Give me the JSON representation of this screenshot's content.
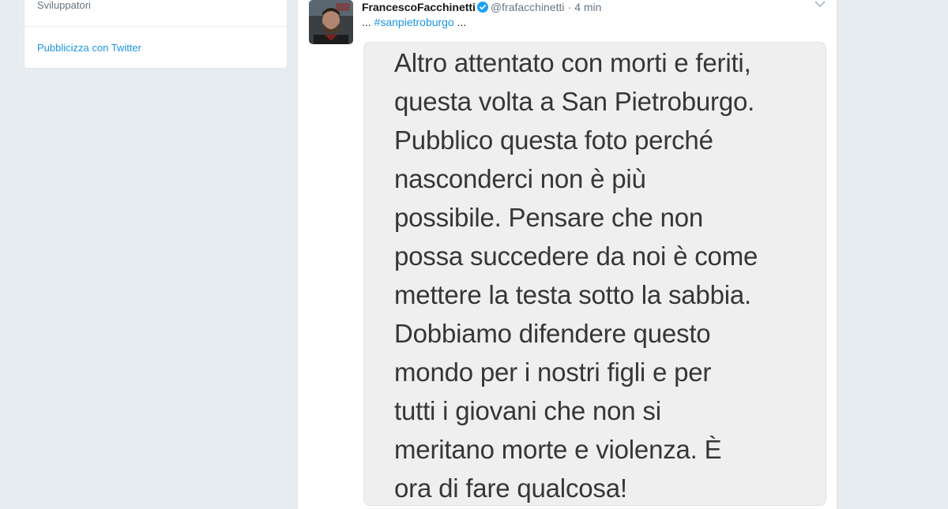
{
  "sidebar": {
    "developers_link": "Sviluppatori",
    "advertise_link": "Pubblicizza con Twitter"
  },
  "tweet": {
    "fullname": "FrancescoFacchinetti",
    "username": "@frafacchinetti",
    "separator": "·",
    "time": "4 min",
    "text_prefix": "...",
    "hashtag": "#sanpietroburgo",
    "text_suffix": "...",
    "media": {
      "lines": [
        "Altro attentato con morti e feriti,",
        "questa volta a San Pietroburgo.",
        "Pubblico questa foto perché",
        "nasconderci non è più",
        "possibile. Pensare che non",
        "possa succedere da noi è come",
        "mettere la testa sotto la sabbia.",
        "Dobbiamo difendere questo",
        "mondo per i nostri figli e per",
        "tutti i giovani che non si",
        "meritano morte e violenza. È",
        "ora di fare qualcosa!"
      ]
    }
  },
  "colors": {
    "link": "#1b95e0",
    "verified": "#1da1f2",
    "page_bg": "#e6ecf0"
  },
  "icons": {
    "verified": "verified-badge-icon",
    "caret": "chevron-down-icon"
  }
}
